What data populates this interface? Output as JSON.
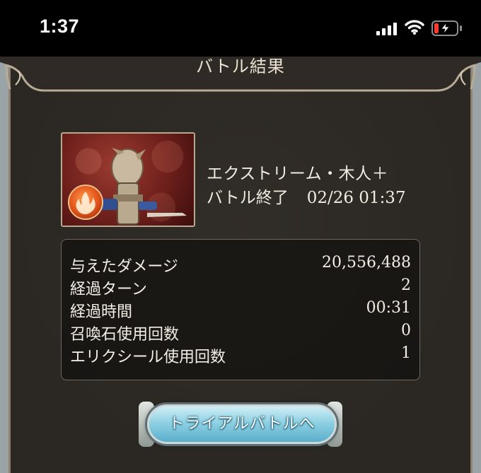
{
  "status_bar": {
    "time": "1:37",
    "icons": [
      "cellular-signal-icon",
      "wifi-icon",
      "battery-low-charging-icon"
    ]
  },
  "header": {
    "title": "バトル結果"
  },
  "quest": {
    "name": "エクストリーム・木人＋",
    "battle_end_label": "バトル終了",
    "battle_end_datetime": "02/26 01:37",
    "thumbnail_icons": [
      "wooden-dummy-portrait",
      "fire-element-icon"
    ]
  },
  "stats": [
    {
      "label": "与えたダメージ",
      "value": "20,556,488"
    },
    {
      "label": "経過ターン",
      "value": "2"
    },
    {
      "label": "経過時間",
      "value": "00:31"
    },
    {
      "label": "召喚石使用回数",
      "value": "0"
    },
    {
      "label": "エリクシール使用回数",
      "value": "1"
    }
  ],
  "actions": {
    "trial_battle_label": "トライアルバトルへ"
  },
  "colors": {
    "panel_background": "#2b2723",
    "text": "#f2eee6",
    "button_blue": "#8fd1e3",
    "battery_red": "#ff3b30"
  }
}
